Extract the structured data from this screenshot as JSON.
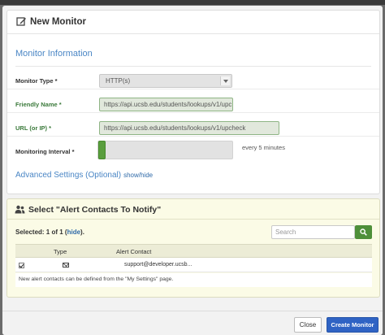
{
  "modal": {
    "title": "New Monitor"
  },
  "monitor_info": {
    "section_title": "Monitor Information",
    "type_label": "Monitor Type *",
    "type_value": "HTTP(s)",
    "friendly_label": "Friendly Name *",
    "friendly_value": "https://api.ucsb.edu/students/lookups/v1/upc",
    "url_label": "URL (or IP) *",
    "url_value": "https://api.ucsb.edu/students/lookups/v1/upcheck",
    "interval_label": "Monitoring Interval *",
    "interval_level": 0.0,
    "interval_note": "every 5 minutes"
  },
  "advanced": {
    "title": "Advanced Settings (Optional)",
    "toggle": "show/hide"
  },
  "alerts": {
    "title": "Select \"Alert Contacts To Notify\"",
    "selected_prefix": "Selected: 1 of 1 (",
    "selected_link": "hide",
    "selected_suffix": ").",
    "search_placeholder": "Search",
    "columns": [
      "Type",
      "Alert Contact"
    ],
    "rows": [
      {
        "checked": true,
        "type_icon": "mail-icon",
        "contact": "support@developer.ucsb..."
      }
    ],
    "note": "New alert contacts can be defined from the \"My Settings\" page."
  },
  "footer": {
    "close": "Close",
    "create": "Create Monitor"
  },
  "colors": {
    "accent_green": "#5a9e3e",
    "primary_blue": "#2f63c4",
    "link_blue": "#4a86c5"
  }
}
